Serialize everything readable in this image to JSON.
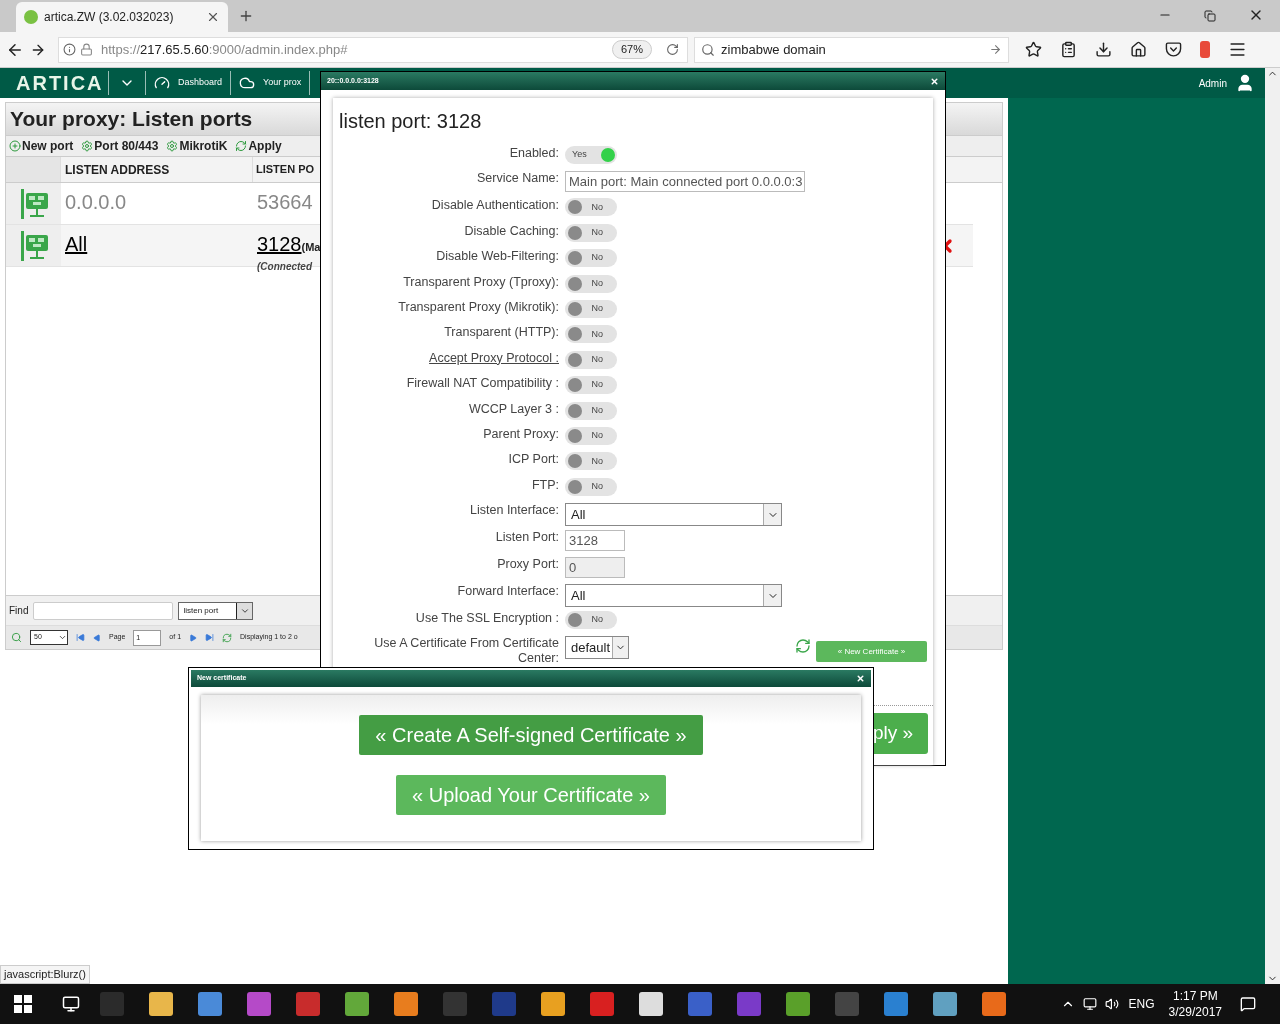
{
  "browser": {
    "tab_title": "artica.ZW (3.02.032023)",
    "url_scheme": "https://",
    "url_host": "217.65.5.60",
    "url_rest": ":9000/admin.index.php#",
    "zoom": "67%",
    "search": "zimbabwe domain"
  },
  "app_header": {
    "logo": "ARTICA",
    "nav": [
      {
        "label": "Dashboard",
        "kind": "dashboard"
      },
      {
        "label": "Your prox",
        "kind": "cloud"
      }
    ],
    "user": "Admin"
  },
  "page": {
    "title": "Your proxy: Listen ports",
    "toolbar": [
      {
        "label": "New port",
        "kind": "add"
      },
      {
        "label": "Port 80/443",
        "kind": "gear"
      },
      {
        "label": "MikrotiK",
        "kind": "gear"
      },
      {
        "label": "Apply",
        "kind": "refresh"
      }
    ],
    "columns": [
      "LISTEN ADDRESS",
      "LISTEN PO"
    ],
    "rows": [
      {
        "address": "0.0.0.0",
        "port": "53664",
        "enabled": false
      },
      {
        "address": "All",
        "port": "3128",
        "note": "(Ma",
        "sub": "(Connected",
        "enabled": true
      }
    ],
    "find": {
      "label": "Find",
      "option": "listen port"
    },
    "pager": {
      "per_page": "50",
      "page_label": "Page",
      "page": "1",
      "of": "of 1",
      "displaying": "Displaying 1 to 2 o"
    }
  },
  "dialog": {
    "title": "20::0.0.0.0:3128",
    "heading": "listen port: 3128",
    "fields": [
      {
        "label": "Enabled:",
        "kind": "toggle",
        "on": true,
        "text": "Yes"
      },
      {
        "label": "Service Name:",
        "kind": "text",
        "value": "Main port: Main connected port 0.0.0.0:3"
      },
      {
        "label": "Disable Authentication:",
        "kind": "toggle",
        "on": false,
        "text": "No"
      },
      {
        "label": "Disable Caching:",
        "kind": "toggle",
        "on": false,
        "text": "No"
      },
      {
        "label": "Disable Web-Filtering:",
        "kind": "toggle",
        "on": false,
        "text": "No"
      },
      {
        "label": "Transparent Proxy (Tproxy):",
        "kind": "toggle",
        "on": false,
        "text": "No"
      },
      {
        "label": "Transparent Proxy (Mikrotik):",
        "kind": "toggle",
        "on": false,
        "text": "No"
      },
      {
        "label": "Transparent (HTTP):",
        "kind": "toggle",
        "on": false,
        "text": "No"
      },
      {
        "label": "Accept Proxy Protocol :",
        "kind": "toggle",
        "on": false,
        "text": "No",
        "link": true
      },
      {
        "label": "Firewall NAT Compatibility :",
        "kind": "toggle",
        "on": false,
        "text": "No"
      },
      {
        "label": "WCCP Layer 3 :",
        "kind": "toggle",
        "on": false,
        "text": "No"
      },
      {
        "label": "Parent Proxy:",
        "kind": "toggle",
        "on": false,
        "text": "No"
      },
      {
        "label": "ICP Port:",
        "kind": "toggle",
        "on": false,
        "text": "No"
      },
      {
        "label": "FTP:",
        "kind": "toggle",
        "on": false,
        "text": "No"
      },
      {
        "label": "Listen Interface:",
        "kind": "select",
        "value": "All"
      },
      {
        "label": "Listen Port:",
        "kind": "text_small",
        "value": "3128",
        "disabled": false
      },
      {
        "label": "Proxy Port:",
        "kind": "text_small",
        "value": "0",
        "disabled": true
      },
      {
        "label": "Forward Interface:",
        "kind": "select",
        "value": "All"
      },
      {
        "label": "Use The SSL Encryption :",
        "kind": "toggle",
        "on": false,
        "text": "No"
      },
      {
        "label": "Use A Certificate From Certificate Center:",
        "kind": "select_small",
        "value": "default"
      }
    ],
    "new_cert": "« New Certificate »",
    "apply": "ply »"
  },
  "cert_dialog": {
    "title": "New certificate",
    "buttons": [
      {
        "label": "« Create A Self-signed Certificate »",
        "hover": true
      },
      {
        "label": "« Upload Your Certificate »",
        "hover": false
      }
    ]
  },
  "status_text": "javascript:Blurz()",
  "taskbar": {
    "lang": "ENG",
    "time": "1:17 PM",
    "date": "3/29/2017"
  }
}
